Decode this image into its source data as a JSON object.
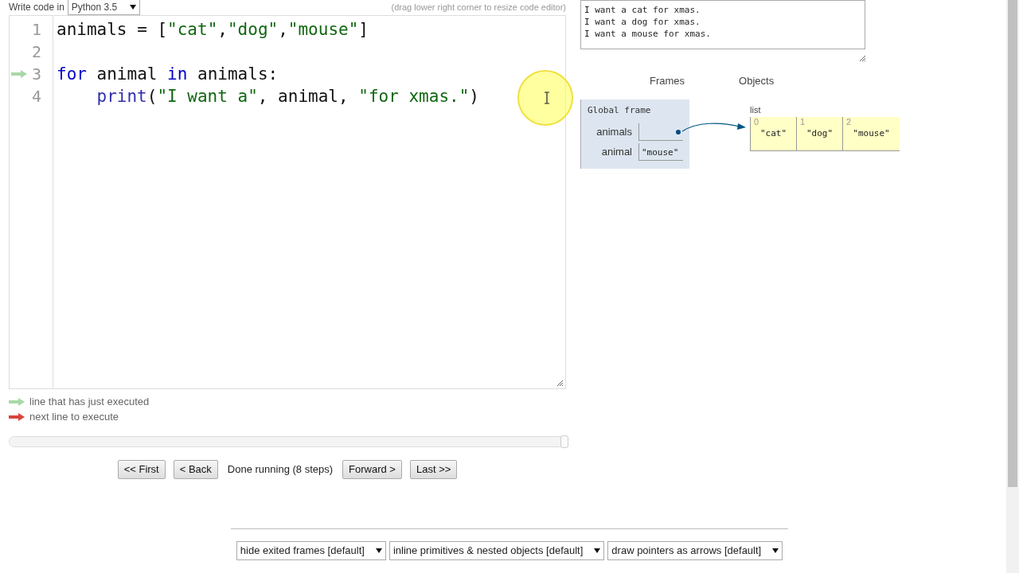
{
  "editor_header": {
    "label": "Write code in",
    "language": "Python 3.5",
    "hint": "(drag lower right corner to resize code editor)"
  },
  "code": {
    "lines": [
      {
        "number": "1",
        "just_executed": false,
        "tokens": [
          {
            "kind": "plain",
            "text": "animals = ["
          },
          {
            "kind": "string",
            "text": "\"cat\""
          },
          {
            "kind": "plain",
            "text": ","
          },
          {
            "kind": "string",
            "text": "\"dog\""
          },
          {
            "kind": "plain",
            "text": ","
          },
          {
            "kind": "string",
            "text": "\"mouse\""
          },
          {
            "kind": "plain",
            "text": "]"
          }
        ]
      },
      {
        "number": "2",
        "just_executed": false
      },
      {
        "number": "3",
        "just_executed": true,
        "tokens": [
          {
            "kind": "keyword",
            "text": "for"
          },
          {
            "kind": "plain",
            "text": " animal "
          },
          {
            "kind": "keyword",
            "text": "in"
          },
          {
            "kind": "plain",
            "text": " animals:"
          }
        ],
        "children": [
          {
            "number": "4",
            "just_executed": false,
            "tokens": [
              {
                "kind": "builtin",
                "text": "print"
              },
              {
                "kind": "plain",
                "text": "("
              },
              {
                "kind": "string",
                "text": "\"I want a\""
              },
              {
                "kind": "plain",
                "text": ", animal, "
              },
              {
                "kind": "string",
                "text": "\"for xmas.\""
              },
              {
                "kind": "plain",
                "text": ")"
              }
            ]
          }
        ]
      }
    ]
  },
  "legend": [
    {
      "kind": "just_executed",
      "label": "line that has just executed"
    },
    {
      "kind": "next",
      "label": "next line to execute"
    }
  ],
  "step_slider": {
    "level": 1.0
  },
  "controls": {
    "first": "<< First",
    "back": "< Back",
    "status": "Done running (8 steps)",
    "forward": "Forward >",
    "last": "Last >>"
  },
  "output": [
    "I want a cat for xmas.",
    "I want a dog for xmas.",
    "I want a mouse for xmas."
  ],
  "visualization": {
    "frames_heading": "Frames",
    "objects_heading": "Objects",
    "frame": {
      "title": "Global frame",
      "variables": [
        {
          "name": "animals",
          "kind": "pointer"
        },
        {
          "name": "animal",
          "kind": "value",
          "value": "\"mouse\""
        }
      ]
    },
    "list": {
      "label": "list",
      "items": [
        {
          "index": "0",
          "value": "\"cat\""
        },
        {
          "index": "1",
          "value": "\"dog\""
        },
        {
          "index": "2",
          "value": "\"mouse\""
        }
      ]
    }
  },
  "options": [
    "hide exited frames [default]",
    "inline primitives & nested objects [default]",
    "draw pointers as arrows [default]"
  ]
}
